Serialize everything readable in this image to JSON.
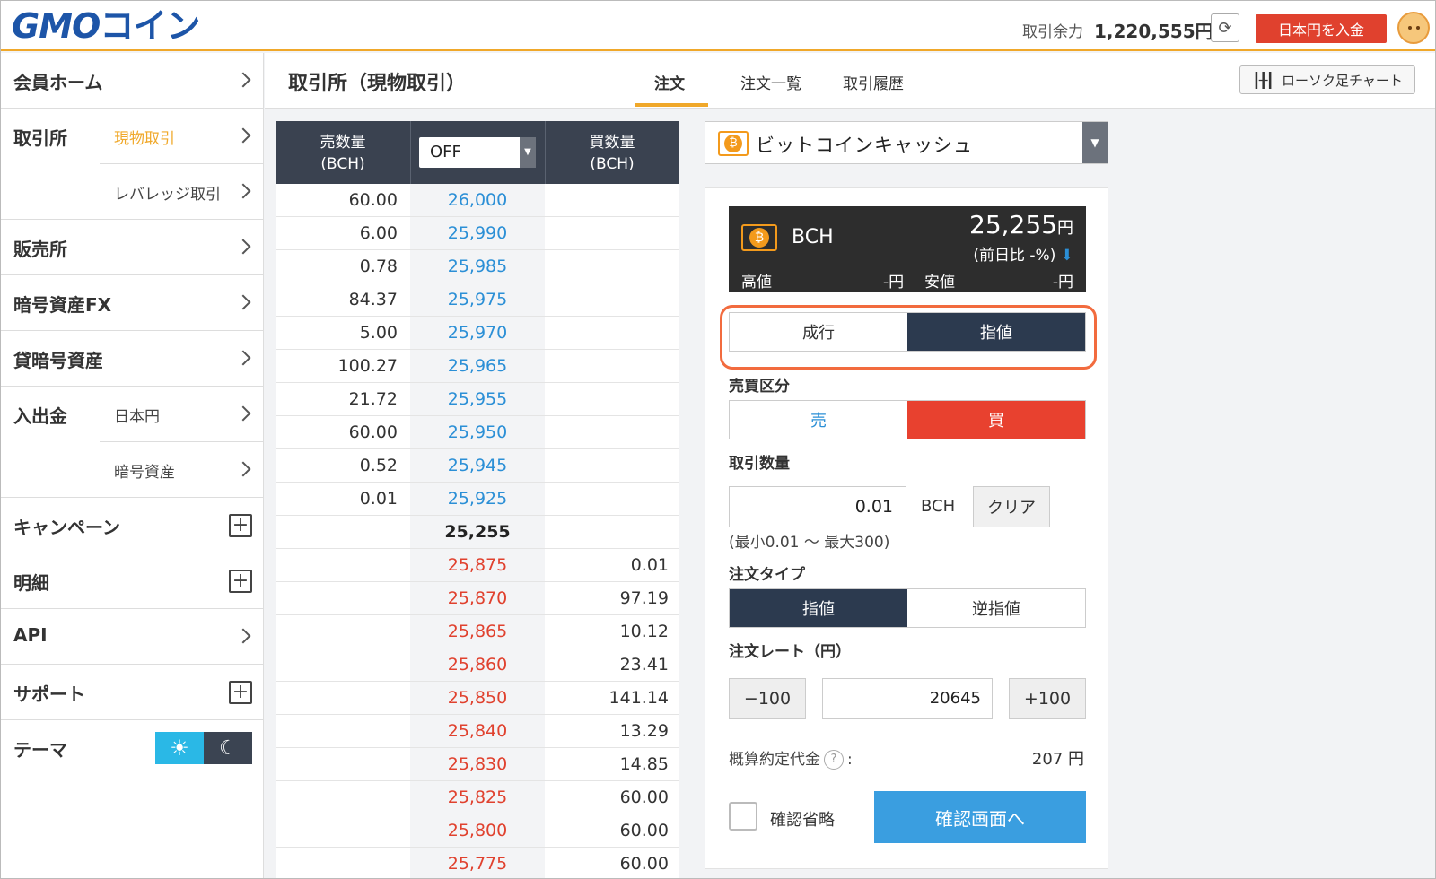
{
  "header": {
    "logo_gmo": "GMO",
    "logo_coin": "コイン",
    "balance_label": "取引余力",
    "balance_value": "1,220,555円",
    "refresh_icon": "refresh-icon",
    "deposit_label": "日本円を入金"
  },
  "sidebar": {
    "home": "会員ホーム",
    "exchange": "取引所",
    "exchange_spot": "現物取引",
    "exchange_leverage": "レバレッジ取引",
    "sales": "販売所",
    "fx": "暗号資産FX",
    "lending": "貸暗号資産",
    "deposit": "入出金",
    "deposit_jpy": "日本円",
    "deposit_crypto": "暗号資産",
    "campaign": "キャンペーン",
    "statement": "明細",
    "api": "API",
    "support": "サポート",
    "theme": "テーマ"
  },
  "main": {
    "title": "取引所（現物取引）",
    "tabs": [
      "注文",
      "注文一覧",
      "取引履歴"
    ],
    "candle_label": "ローソク足チャート"
  },
  "orderbook": {
    "sell_header_1": "売数量",
    "sell_header_2": "(BCH)",
    "buy_header_1": "買数量",
    "buy_header_2": "(BCH)",
    "grouping_value": "OFF",
    "asks": [
      {
        "qty": "60.00",
        "price": "26,000"
      },
      {
        "qty": "6.00",
        "price": "25,990"
      },
      {
        "qty": "0.78",
        "price": "25,985"
      },
      {
        "qty": "84.37",
        "price": "25,975"
      },
      {
        "qty": "5.00",
        "price": "25,970"
      },
      {
        "qty": "100.27",
        "price": "25,965"
      },
      {
        "qty": "21.72",
        "price": "25,955"
      },
      {
        "qty": "60.00",
        "price": "25,950"
      },
      {
        "qty": "0.52",
        "price": "25,945"
      },
      {
        "qty": "0.01",
        "price": "25,925"
      }
    ],
    "mid_price": "25,255",
    "bids": [
      {
        "price": "25,875",
        "qty": "0.01"
      },
      {
        "price": "25,870",
        "qty": "97.19"
      },
      {
        "price": "25,865",
        "qty": "10.12"
      },
      {
        "price": "25,860",
        "qty": "23.41"
      },
      {
        "price": "25,850",
        "qty": "141.14"
      },
      {
        "price": "25,840",
        "qty": "13.29"
      },
      {
        "price": "25,830",
        "qty": "14.85"
      },
      {
        "price": "25,825",
        "qty": "60.00"
      },
      {
        "price": "25,800",
        "qty": "60.00"
      },
      {
        "price": "25,775",
        "qty": "60.00"
      }
    ],
    "colors": {
      "ask": "#2b8fd6",
      "bid": "#e0412e"
    }
  },
  "order": {
    "symbol_name": "ビットコインキャッシュ",
    "ticker_symbol": "BCH",
    "price": "25,255",
    "price_unit": "円",
    "change": "(前日比 -%)",
    "high_label": "高値",
    "high_value": "-円",
    "low_label": "安値",
    "low_value": "-円",
    "exec_market": "成行",
    "exec_limit": "指値",
    "side_label": "売買区分",
    "side_sell": "売",
    "side_buy": "買",
    "qty_label": "取引数量",
    "qty_value": "0.01",
    "qty_unit": "BCH",
    "clear_label": "クリア",
    "qty_range": "(最小0.01 〜 最大300)",
    "type_label": "注文タイプ",
    "type_limit": "指値",
    "type_stop": "逆指値",
    "rate_label": "注文レート（円）",
    "rate_minus": "−100",
    "rate_value": "20645",
    "rate_plus": "+100",
    "est_label": "概算約定代金",
    "est_sep": ":",
    "est_value": "207 円",
    "skip_confirm": "確認省略",
    "confirm_label": "確認画面へ"
  }
}
